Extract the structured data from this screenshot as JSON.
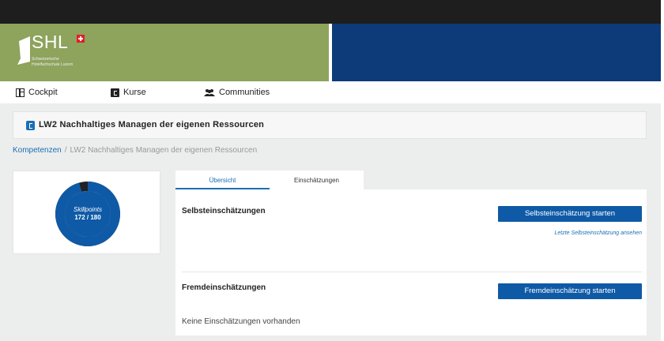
{
  "logo": {
    "name": "SHL",
    "line1": "Schweizerische",
    "line2": "Hotelfachschule Luzern"
  },
  "nav": {
    "items": [
      {
        "label": "Cockpit",
        "icon": "grid-icon"
      },
      {
        "label": "Kurse",
        "icon": "book-icon"
      },
      {
        "label": "Communities",
        "icon": "people-icon"
      }
    ]
  },
  "course": {
    "title": "LW2 Nachhaltiges Managen der eigenen Ressourcen"
  },
  "breadcrumb": {
    "root": "Kompetenzen",
    "separator": "/",
    "current": "LW2 Nachhaltiges Managen der eigenen Ressourcen"
  },
  "skillpoints": {
    "label": "Skillpoints",
    "display": "172 / 180",
    "current": 172,
    "max": 180,
    "ring_color": "#0f5aa6",
    "remaining_color": "#222222"
  },
  "tabs": [
    {
      "label": "Übersicht",
      "active": true
    },
    {
      "label": "Einschätzungen",
      "active": false
    }
  ],
  "self_assessment": {
    "title": "Selbsteinschätzungen",
    "button": "Selbsteinschätzung starten",
    "last_link": "Letzte Selbsteinschätzung ansehen"
  },
  "external_assessment": {
    "title": "Fremdeinschätzungen",
    "button": "Fremdeinschätzung starten",
    "empty_text": "Keine Einschätzungen vorhanden"
  },
  "colors": {
    "brand_green": "#8ea35c",
    "brand_blue": "#0d3b7a",
    "accent_blue": "#0f5aa6",
    "swiss_red": "#e41e26"
  }
}
